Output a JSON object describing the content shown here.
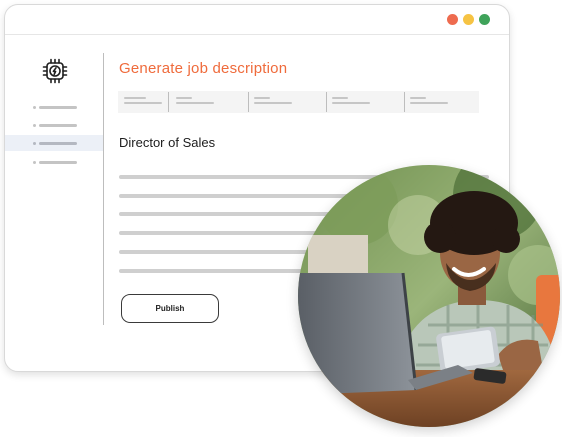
{
  "window": {
    "controls": [
      "close",
      "minimize",
      "maximize"
    ],
    "colors": {
      "close": "#ee6b4f",
      "minimize": "#f6c343",
      "maximize": "#3fa35a"
    }
  },
  "sidebar": {
    "logo_icon": "chip-lightning-icon",
    "items": [
      {
        "label": "",
        "active": false
      },
      {
        "label": "",
        "active": false
      },
      {
        "label": "",
        "active": true
      },
      {
        "label": "",
        "active": false
      }
    ]
  },
  "main": {
    "title": "Generate job description",
    "job_title": "Director of Sales",
    "publish_label": "Publish"
  },
  "theme": {
    "accent": "#ef6b3c",
    "active_bg": "#ecf0f7"
  },
  "photo": {
    "subject": "smiling-man-with-laptop-and-tablet"
  }
}
